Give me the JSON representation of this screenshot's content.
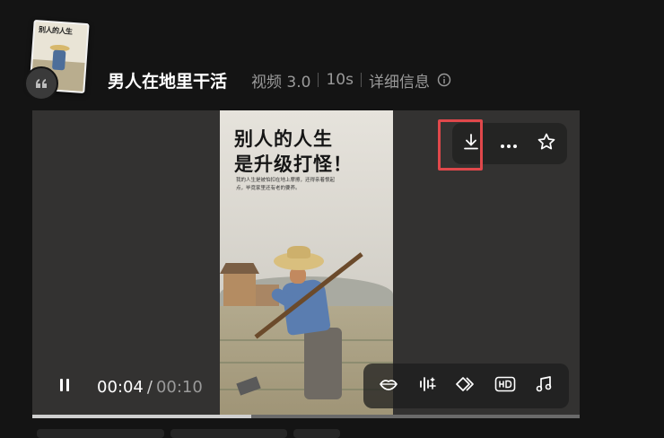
{
  "item": {
    "title": "男人在地里干活",
    "meta_model": "视频 3.0",
    "meta_duration": "10s",
    "meta_details": "详细信息"
  },
  "thumbnail": {
    "text": "别人的人生"
  },
  "video": {
    "headline_line1": "别人的人生",
    "headline_line2": "是升级打怪！",
    "body": "我的人生是被怕扣在地上摩擦，还得亲着恨起点，毕竟家里还有老的要养。"
  },
  "player": {
    "current_time": "00:04",
    "separator": "/",
    "duration": "00:10",
    "progress": 0.4
  },
  "icons": {
    "quote": "quote-icon",
    "info": "info-icon",
    "download": "download-icon",
    "more": "more-icon",
    "favorite": "star-icon",
    "pause": "pause-icon",
    "lips": "lip-sync-icon",
    "audio": "audio-wave-icon",
    "frames": "frames-icon",
    "hd": "hd-icon",
    "music": "music-icon"
  },
  "colors": {
    "background": "#141414",
    "highlight": "#e0484b",
    "meta_text": "#9a9a9a"
  }
}
